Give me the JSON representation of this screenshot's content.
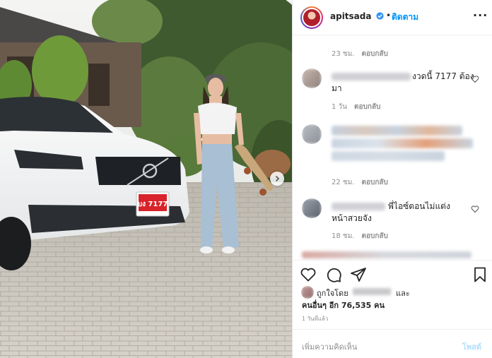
{
  "header": {
    "username": "apitsada",
    "separator": "•",
    "follow_label": "ติดตาม",
    "more_icon": "more-horizontal-icon"
  },
  "comments": [
    {
      "time": "23 ชม.",
      "reply_label": "ตอบกลับ",
      "text": ""
    },
    {
      "time": "1 วัน",
      "reply_label": "ตอบกลับ",
      "text_line1": "งวดนี้ 7177 ต้อง",
      "text_line2": "มา"
    },
    {
      "time": "22 ชม.",
      "reply_label": "ตอบกลับ",
      "text": ""
    },
    {
      "time": "18 ชม.",
      "reply_label": "ตอบกลับ",
      "text_line1": "พี่ไอซ์ตอนไม่แต่ง",
      "text_line2": "หน้าสวยจัง"
    }
  ],
  "actions": {
    "like_icon": "heart-icon",
    "comment_icon": "comment-icon",
    "share_icon": "send-icon",
    "save_icon": "bookmark-icon"
  },
  "likes": {
    "prefix": "ถูกใจโดย",
    "suffix": "และ",
    "others": "คนอื่นๆ อีก 76,535 คน"
  },
  "timestamp": "1 วันที่แล้ว",
  "add_comment": {
    "placeholder": "เพิ่มความคิดเห็น",
    "post_label": "โพสต์"
  },
  "photo": {
    "plate_text": "บง 7177",
    "carousel_icon": "chevron-right-icon"
  },
  "colors": {
    "link": "#0095f6",
    "text": "#262626",
    "muted": "#8e8e8e",
    "post_disabled": "#b2dffc"
  }
}
